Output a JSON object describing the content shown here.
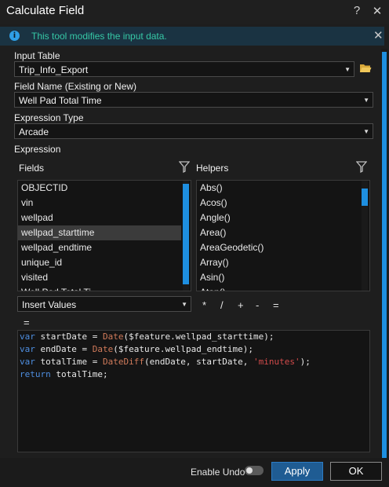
{
  "window": {
    "title": "Calculate Field",
    "help": "?",
    "close": "✕"
  },
  "notice": {
    "icon": "i",
    "text": "This tool modifies the input data.",
    "close": "✕"
  },
  "input_table": {
    "label": "Input Table",
    "value": "Trip_Info_Export"
  },
  "field_name": {
    "label": "Field Name (Existing or New)",
    "value": "Well Pad Total Time"
  },
  "expression_type": {
    "label": "Expression Type",
    "value": "Arcade"
  },
  "expression": {
    "label": "Expression"
  },
  "fields": {
    "label": "Fields",
    "items": [
      "OBJECTID",
      "vin",
      "wellpad",
      "wellpad_starttime",
      "wellpad_endtime",
      "unique_id",
      "visited",
      "Well Pad Total Ti"
    ],
    "selected": "wellpad_starttime"
  },
  "helpers": {
    "label": "Helpers",
    "items": [
      "Abs()",
      "Acos()",
      "Angle()",
      "Area()",
      "AreaGeodetic()",
      "Array()",
      "Asin()",
      "Atan()"
    ]
  },
  "insert": {
    "value": "Insert Values"
  },
  "operators": [
    "*",
    "/",
    "+",
    "-",
    "="
  ],
  "equals_label": "=",
  "code": {
    "line1": {
      "kw": "var",
      "a": " startDate = ",
      "fn": "Date",
      "b": "($feature.wellpad_starttime);"
    },
    "line2": {
      "kw": "var",
      "a": " endDate = ",
      "fn": "Date",
      "b": "($feature.wellpad_endtime);"
    },
    "line3": {
      "kw": "var",
      "a": " totalTime = ",
      "fn": "DateDiff",
      "b": "(endDate, startDate, ",
      "str": "'minutes'",
      "c": ");"
    },
    "line4": {
      "kw": "return",
      "a": " totalTime;"
    }
  },
  "footer": {
    "undo_label": "Enable Undo",
    "undo_enabled": false,
    "apply": "Apply",
    "ok": "OK"
  },
  "colors": {
    "accent": "#1e8fe0",
    "notice_text": "#36c8a6",
    "keyword": "#4e8ee0",
    "function": "#d07a5a",
    "string": "#d34b4b"
  }
}
